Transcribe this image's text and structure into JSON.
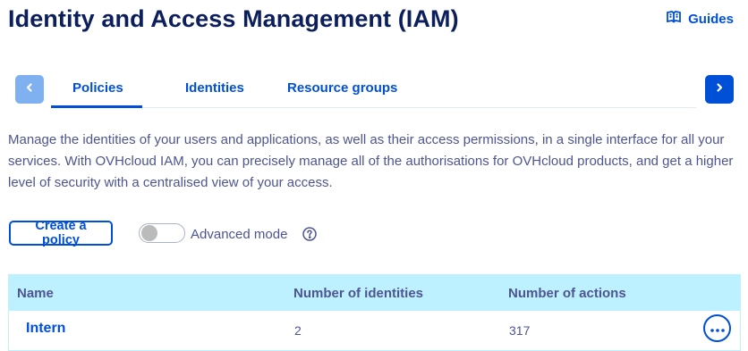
{
  "page": {
    "title": "Identity and Access Management (IAM)",
    "guides_label": "Guides"
  },
  "tabs": [
    {
      "label": "Policies",
      "active": true
    },
    {
      "label": "Identities",
      "active": false
    },
    {
      "label": "Resource groups",
      "active": false
    }
  ],
  "description": "Manage the identities of your users and applications, as well as their access permissions, in a single interface for all your services. With OVHcloud IAM, you can precisely manage all of the authorisations for OVHcloud products, and get a higher level of security with a centralised view of your access.",
  "actions": {
    "create_label": "Create a policy",
    "advanced_mode_label": "Advanced mode",
    "advanced_mode_on": false
  },
  "table": {
    "headers": [
      "Name",
      "Number of identities",
      "Number of actions"
    ],
    "rows": [
      {
        "name": "Intern",
        "identities": "2",
        "actions": "317"
      }
    ]
  },
  "icons": {
    "guides": "book-open-icon",
    "prev": "chevron-left-icon",
    "next": "chevron-right-icon",
    "help": "question-circle-icon",
    "more": "ellipsis-icon"
  },
  "colors": {
    "primary": "#0050d7",
    "title": "#0c1f5c",
    "text": "#4d5592",
    "table_header_bg": "#bef1ff",
    "arrow_disabled": "#7fb0f0"
  }
}
